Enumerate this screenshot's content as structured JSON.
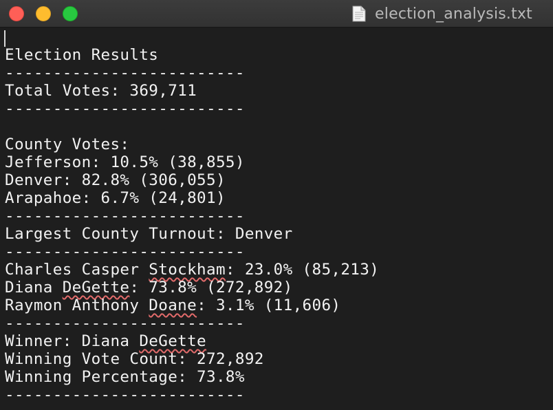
{
  "window": {
    "title": "election_analysis.txt",
    "file_icon": "document-icon"
  },
  "colors": {
    "background": "#1e1e1e",
    "text": "#f2f2f2",
    "spellcheck_underline": "#e26b6b"
  },
  "content": {
    "heading": "Election Results",
    "divider": "-------------------------",
    "total_votes": "Total Votes: 369,711",
    "county_votes_header": "County Votes:",
    "counties": [
      "Jefferson: 10.5% (38,855)",
      "Denver: 82.8% (306,055)",
      "Arapahoe: 6.7% (24,801)"
    ],
    "largest_county": "Largest County Turnout: Denver",
    "candidates": [
      {
        "prefix": "Charles Casper ",
        "flagged": "Stockham",
        "suffix": ": 23.0% (85,213)"
      },
      {
        "prefix": "Diana ",
        "flagged": "DeGette",
        "suffix": ": 73.8% (272,892)"
      },
      {
        "prefix": "Raymon Anthony ",
        "flagged": "Doane",
        "suffix": ": 3.1% (11,606)"
      }
    ],
    "winner": {
      "prefix": "Winner: Diana ",
      "flagged": "DeGette"
    },
    "winning_vote_count": "Winning Vote Count: 272,892",
    "winning_percentage": "Winning Percentage: 73.8%"
  }
}
